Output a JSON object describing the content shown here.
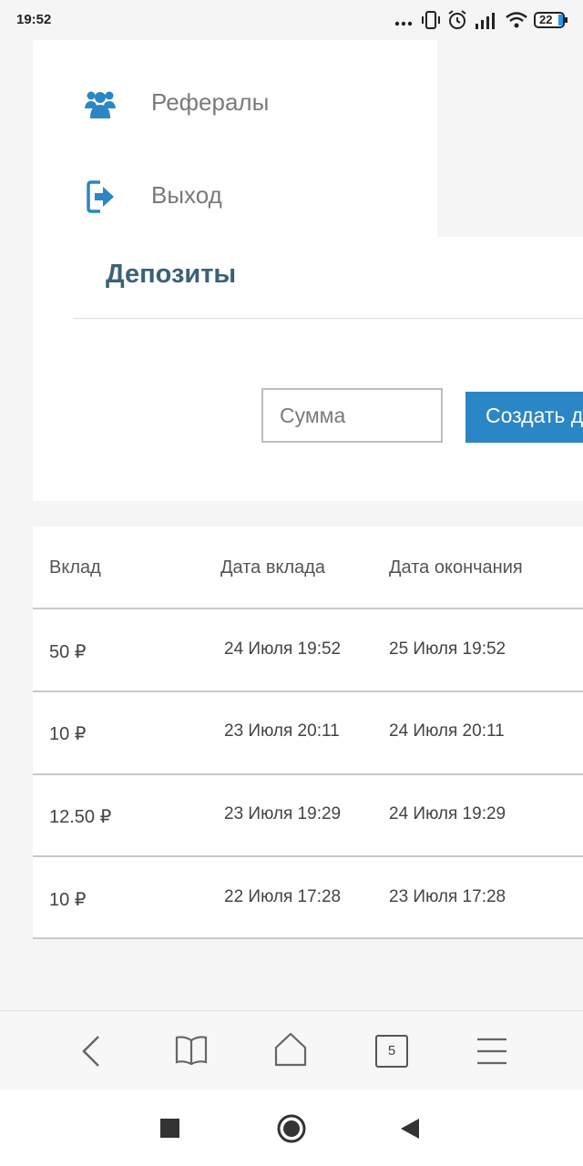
{
  "status_bar": {
    "time": "19:52",
    "battery": "22"
  },
  "menu": {
    "items": [
      {
        "label": "Рефералы",
        "icon": "users-icon"
      },
      {
        "label": "Выход",
        "icon": "logout-icon"
      }
    ]
  },
  "deposits": {
    "title": "Депозиты",
    "amount_placeholder": "Сумма",
    "create_button": "Создать д"
  },
  "table": {
    "headers": [
      "Вклад",
      "Дата вклада",
      "Дата окончания"
    ],
    "rows": [
      [
        "50 ₽",
        "24 Июля 19:52",
        "25 Июля 19:52"
      ],
      [
        "10 ₽",
        "23 Июля 20:11",
        "24 Июля 20:11"
      ],
      [
        "12.50 ₽",
        "23 Июля 19:29",
        "24 Июля 19:29"
      ],
      [
        "10 ₽",
        "22 Июля 17:28",
        "23 Июля 17:28"
      ]
    ]
  },
  "browser": {
    "tab_count": "5"
  },
  "colors": {
    "accent": "#2a86c4",
    "title": "#3b6178",
    "icon": "#2a86c4"
  }
}
